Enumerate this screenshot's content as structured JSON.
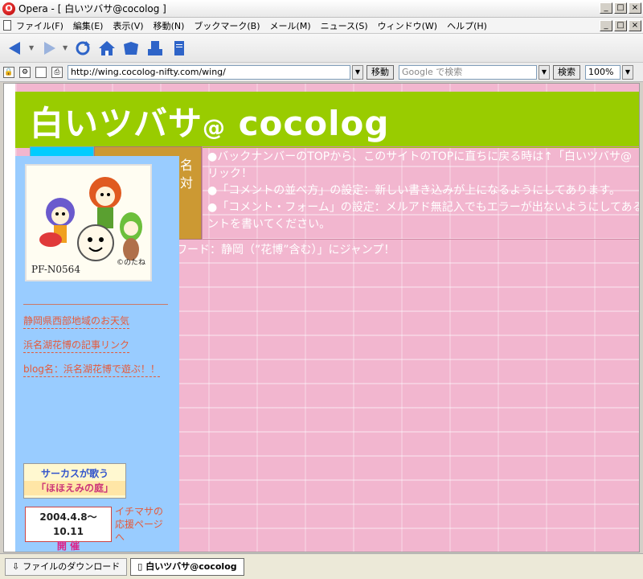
{
  "window": {
    "title": "Opera - [ 白いツバサ@cocolog ]",
    "minimize": "_",
    "maximize": "□",
    "close": "×"
  },
  "menu": {
    "items": [
      "ファイル(F)",
      "編集(E)",
      "表示(V)",
      "移動(N)",
      "ブックマーク(B)",
      "メール(M)",
      "ニュース(S)",
      "ウィンドウ(W)",
      "ヘルプ(H)"
    ]
  },
  "toolbar": {
    "icons": [
      "back-icon",
      "forward-icon",
      "reload-icon",
      "home-icon",
      "hotlist-icon",
      "print-icon",
      "page-icon"
    ]
  },
  "address": {
    "url": "http://wing.cocolog-nifty.com/wing/",
    "go_label": "移動",
    "search_placeholder": "Google で検索",
    "search_label": "検索",
    "zoom": "100%"
  },
  "page": {
    "title_main": "白いツバサ",
    "title_at": "@",
    "title_tail": " cocolog",
    "orange_text_1": "名",
    "orange_text_2": "対",
    "notice_1": "●バックナンバーのTOPから、このサイトのTOPに直ちに戻る時は↑「白いツバサ@",
    "notice_1b": "リック！",
    "notice_2": "●「コメントの並べ方」の設定：新しい書き込みが上になるようにしてあります。",
    "notice_3": "●「コメント・フォーム」の設定：メルアド無記入でもエラーが出ないようにしてあるので",
    "notice_3b": "ントを書いてください。",
    "keyword": "ーワード：静岡（”花博”含む）」にジャンプ！"
  },
  "sidebar": {
    "mascot_caption": "PF-N0564",
    "mascot_copyright": "©のたね",
    "links": [
      "静岡県西部地域のお天気",
      "浜名湖花博の記事リンク",
      "blog名：浜名湖花博で遊ぶ！！"
    ],
    "circus_line1": "サーカスが歌う",
    "circus_line2": "「ほほえみの庭」",
    "expo_line1": "2004.4.8～10.11",
    "expo_line2": "開 催",
    "expo_link": "イチマサの応援ページへ",
    "dashes": "- - - - - - - - - - - - - - -"
  },
  "status": {
    "downloads": "ファイルのダウンロード",
    "active_tab": "白いツバサ@cocolog"
  },
  "colors": {
    "header_green": "#99cc00",
    "page_pink": "#f2b6cf",
    "sidebar_blue": "#99ccff",
    "link_orange": "#e55a3a",
    "cell_cyan": "#00ccff",
    "cell_orange": "#cc9933"
  }
}
